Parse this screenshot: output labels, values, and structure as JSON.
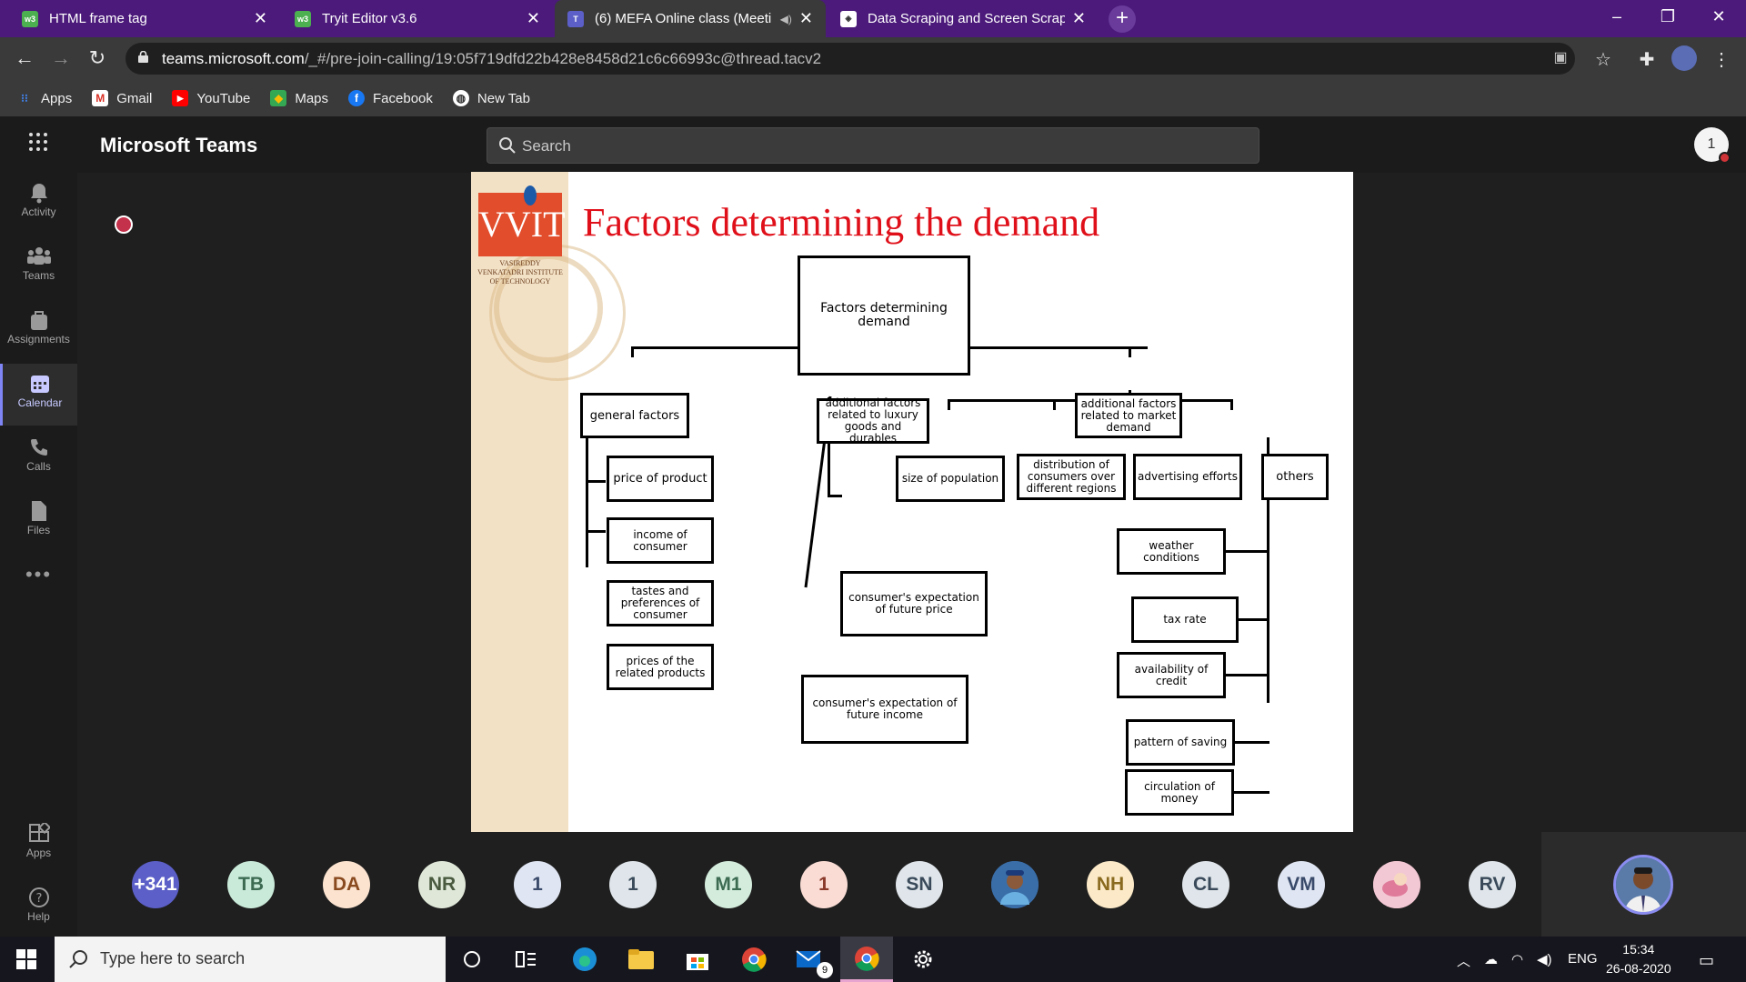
{
  "browser": {
    "tabs": [
      {
        "title": "HTML frame tag",
        "favicon": "w3-icon",
        "color": "#4caf50"
      },
      {
        "title": "Tryit Editor v3.6",
        "favicon": "w3-icon",
        "color": "#4caf50"
      },
      {
        "title": "(6) MEFA Online class (Meeti",
        "favicon": "teams-icon",
        "color": "#5b5fc7"
      },
      {
        "title": "Data Scraping and Screen Scrapi",
        "favicon": "web-icon",
        "color": "#ffffff"
      }
    ],
    "url_host": "teams.microsoft.com",
    "url_path": "/_#/pre-join-calling/19:05f719dfd22b428e8458d21c6c66993c@thread.tacv2",
    "bookmarks": [
      {
        "label": "Apps",
        "icon": "apps-grid-icon"
      },
      {
        "label": "Gmail",
        "icon": "gmail-icon"
      },
      {
        "label": "YouTube",
        "icon": "youtube-icon"
      },
      {
        "label": "Maps",
        "icon": "maps-icon"
      },
      {
        "label": "Facebook",
        "icon": "facebook-icon"
      },
      {
        "label": "New Tab",
        "icon": "newtab-icon"
      }
    ]
  },
  "teams": {
    "app_name": "Microsoft Teams",
    "search_placeholder": "Search",
    "profile_badge": "1",
    "rail": [
      {
        "label": "Activity",
        "icon": "bell-icon"
      },
      {
        "label": "Teams",
        "icon": "teams-icon"
      },
      {
        "label": "Assignments",
        "icon": "assignments-icon"
      },
      {
        "label": "Calendar",
        "icon": "calendar-icon"
      },
      {
        "label": "Calls",
        "icon": "phone-icon"
      },
      {
        "label": "Files",
        "icon": "file-icon"
      },
      {
        "label": "...",
        "icon": "more-icon"
      }
    ],
    "rail_bottom": [
      {
        "label": "Apps",
        "icon": "apps-icon"
      },
      {
        "label": "Help",
        "icon": "help-icon"
      }
    ],
    "participants": [
      {
        "initials": "+341",
        "bg": "#5b5fc7",
        "fg": "#ffffff"
      },
      {
        "initials": "TB",
        "bg": "#c9ead9",
        "fg": "#3c6b52"
      },
      {
        "initials": "DA",
        "bg": "#fbe3cf",
        "fg": "#8a4a1f"
      },
      {
        "initials": "NR",
        "bg": "#dfe8d8",
        "fg": "#4a5a3f"
      },
      {
        "initials": "1",
        "bg": "#dfe5f2",
        "fg": "#3a4a6a"
      },
      {
        "initials": "1",
        "bg": "#dfe5ea",
        "fg": "#3a4a5a"
      },
      {
        "initials": "M1",
        "bg": "#d3ecdc",
        "fg": "#3c6b52"
      },
      {
        "initials": "1",
        "bg": "#fadcd4",
        "fg": "#8a3a2a"
      },
      {
        "initials": "SN",
        "bg": "#dfe5ea",
        "fg": "#3a4a5a"
      },
      {
        "initials": "",
        "bg": "#3a6ea8",
        "fg": "#ffffff",
        "photo": true
      },
      {
        "initials": "NH",
        "bg": "#fbe9c7",
        "fg": "#8a6a1f"
      },
      {
        "initials": "CL",
        "bg": "#dfe5ea",
        "fg": "#3a4a5a"
      },
      {
        "initials": "VM",
        "bg": "#dfe5f2",
        "fg": "#3a4a6a"
      },
      {
        "initials": "",
        "bg": "#e8a8b8",
        "fg": "#ffffff",
        "photo": true
      },
      {
        "initials": "RV",
        "bg": "#dfe5ea",
        "fg": "#3a4a5a"
      }
    ]
  },
  "slide": {
    "logo_text": "VVIT",
    "institute": "VASIREDDY VENKATADRI INSTITUTE OF TECHNOLOGY",
    "title": "Factors determining the demand",
    "nodes": {
      "root": "Factors determining demand",
      "general": "general factors",
      "luxury": "additional factors related to luxury goods and durables",
      "market": "additional factors related to market demand",
      "price": "price of product",
      "income": "income of consumer",
      "tastes": "tastes and preferences of consumer",
      "related": "prices of the related products",
      "exp_price": "consumer's expectation of future price",
      "exp_income": "consumer's expectation of future income",
      "population": "size of population",
      "distribution": "distribution of consumers over different regions",
      "advertising": "advertising efforts",
      "others": "others",
      "weather": "weather conditions",
      "tax": "tax rate",
      "credit": "availability of credit",
      "saving": "pattern of saving",
      "circulation": "circulation of money"
    }
  },
  "taskbar": {
    "search_placeholder": "Type here to search",
    "mail_badge": "9",
    "language": "ENG",
    "time": "15:34",
    "date": "26-08-2020"
  }
}
